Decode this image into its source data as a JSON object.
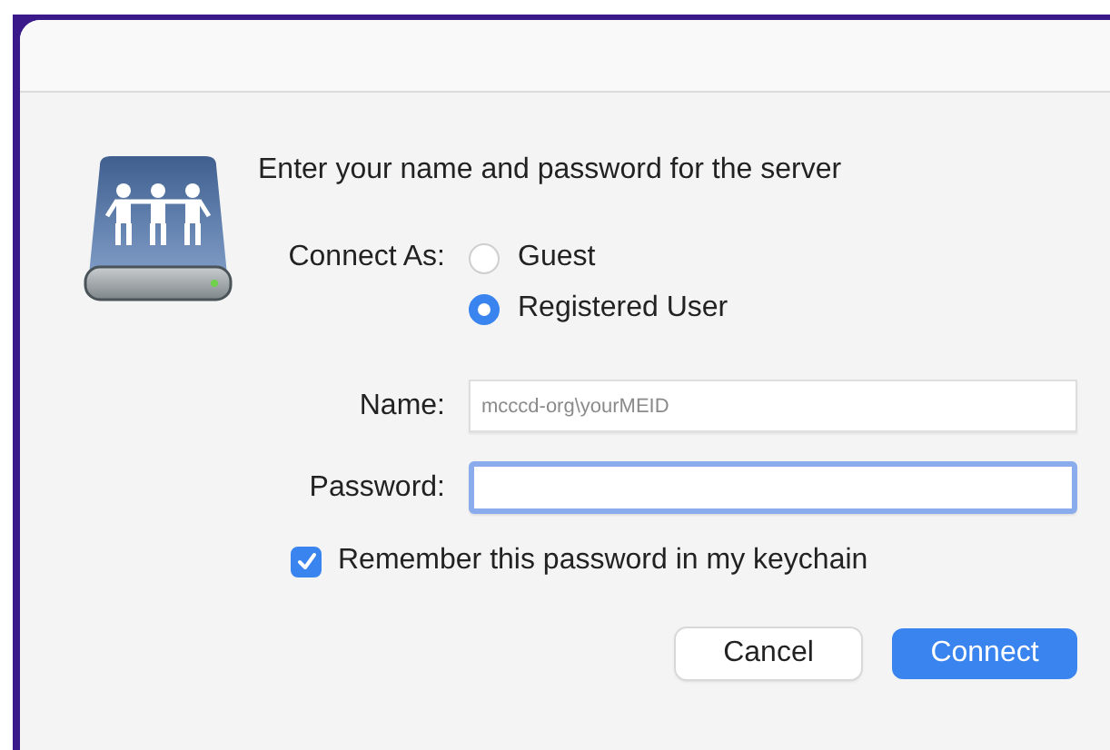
{
  "message": "Enter your name and password for the server",
  "connect_as": {
    "label": "Connect As:",
    "options": [
      {
        "label": "Guest",
        "selected": false
      },
      {
        "label": "Registered User",
        "selected": true
      }
    ]
  },
  "fields": [
    {
      "label": "Name:",
      "placeholder": "mcccd-org\\yourMEID",
      "focused": false
    },
    {
      "label": "Password:",
      "focused": true
    }
  ],
  "remember": {
    "label": "Remember this password in my keychain",
    "checked": true
  },
  "buttons": [
    {
      "label": "Cancel",
      "kind": "secondary"
    },
    {
      "label": "Connect",
      "kind": "default"
    }
  ]
}
